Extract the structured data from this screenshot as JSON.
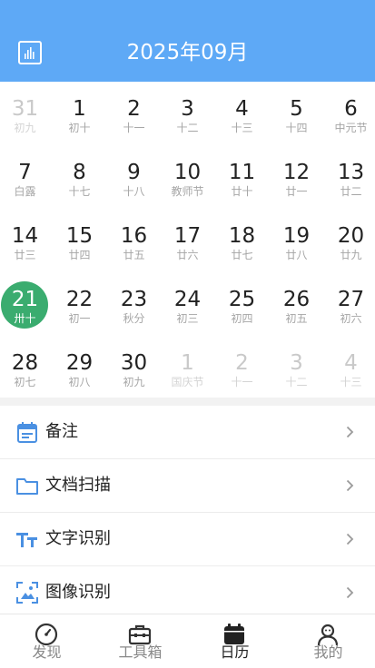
{
  "header": {
    "title": "2025年09月",
    "stats_icon": "bar-chart-icon"
  },
  "colors": {
    "header_bg": "#5ea9f6",
    "today_bg": "#3aac6f",
    "icon_blue": "#4a90e2"
  },
  "calendar": {
    "today": "21",
    "weeks": [
      [
        {
          "day": "31",
          "lunar": "初九",
          "other": true
        },
        {
          "day": "1",
          "lunar": "初十"
        },
        {
          "day": "2",
          "lunar": "十一"
        },
        {
          "day": "3",
          "lunar": "十二"
        },
        {
          "day": "4",
          "lunar": "十三"
        },
        {
          "day": "5",
          "lunar": "十四"
        },
        {
          "day": "6",
          "lunar": "中元节"
        }
      ],
      [
        {
          "day": "7",
          "lunar": "白露"
        },
        {
          "day": "8",
          "lunar": "十七"
        },
        {
          "day": "9",
          "lunar": "十八"
        },
        {
          "day": "10",
          "lunar": "教师节"
        },
        {
          "day": "11",
          "lunar": "廿十"
        },
        {
          "day": "12",
          "lunar": "廿一"
        },
        {
          "day": "13",
          "lunar": "廿二"
        }
      ],
      [
        {
          "day": "14",
          "lunar": "廿三"
        },
        {
          "day": "15",
          "lunar": "廿四"
        },
        {
          "day": "16",
          "lunar": "廿五"
        },
        {
          "day": "17",
          "lunar": "廿六"
        },
        {
          "day": "18",
          "lunar": "廿七"
        },
        {
          "day": "19",
          "lunar": "廿八"
        },
        {
          "day": "20",
          "lunar": "廿九"
        }
      ],
      [
        {
          "day": "21",
          "lunar": "卅十",
          "today": true
        },
        {
          "day": "22",
          "lunar": "初一"
        },
        {
          "day": "23",
          "lunar": "秋分"
        },
        {
          "day": "24",
          "lunar": "初三"
        },
        {
          "day": "25",
          "lunar": "初四"
        },
        {
          "day": "26",
          "lunar": "初五"
        },
        {
          "day": "27",
          "lunar": "初六"
        }
      ],
      [
        {
          "day": "28",
          "lunar": "初七"
        },
        {
          "day": "29",
          "lunar": "初八"
        },
        {
          "day": "30",
          "lunar": "初九"
        },
        {
          "day": "1",
          "lunar": "国庆节",
          "other": true
        },
        {
          "day": "2",
          "lunar": "十一",
          "other": true
        },
        {
          "day": "3",
          "lunar": "十二",
          "other": true
        },
        {
          "day": "4",
          "lunar": "十三",
          "other": true
        }
      ]
    ]
  },
  "menu": {
    "items": [
      {
        "label": "备注",
        "icon": "calendar-note-icon"
      },
      {
        "label": "文档扫描",
        "icon": "folder-icon"
      },
      {
        "label": "文字识别",
        "icon": "text-recognition-icon"
      },
      {
        "label": "图像识别",
        "icon": "image-recognition-icon"
      }
    ]
  },
  "tabbar": {
    "active": "日历",
    "tabs": [
      {
        "label": "发现",
        "icon": "compass-icon"
      },
      {
        "label": "工具箱",
        "icon": "toolbox-icon"
      },
      {
        "label": "日历",
        "icon": "calendar-icon"
      },
      {
        "label": "我的",
        "icon": "user-icon"
      }
    ]
  }
}
